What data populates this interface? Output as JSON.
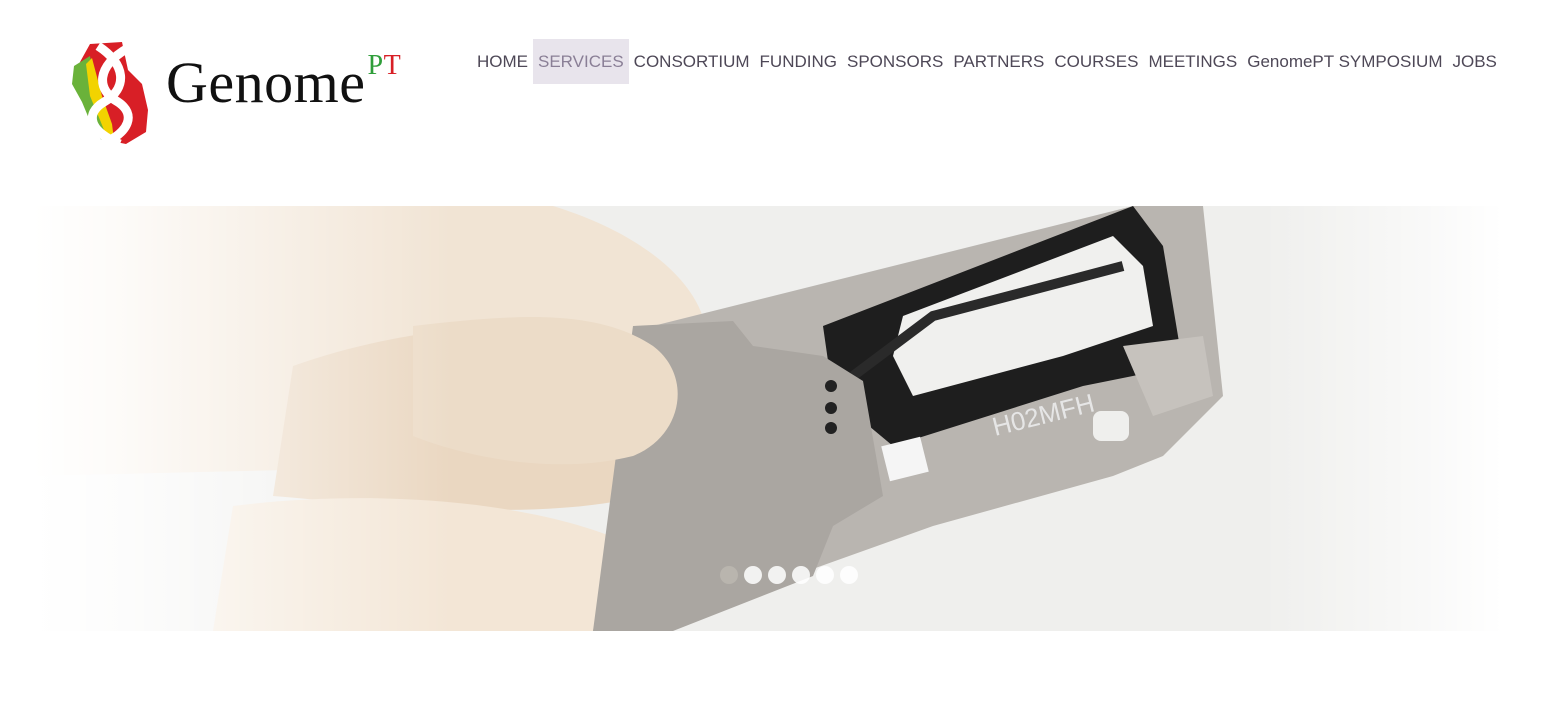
{
  "brand": {
    "name": "Genome",
    "suffix_p": "P",
    "suffix_t": "T",
    "colors": {
      "green": "#2f9e3a",
      "red": "#d81f26",
      "yellow": "#f2d300"
    }
  },
  "nav": {
    "items": [
      {
        "label": "HOME"
      },
      {
        "label": "SERVICES"
      },
      {
        "label": "CONSORTIUM"
      },
      {
        "label": "FUNDING"
      },
      {
        "label": "SPONSORS"
      },
      {
        "label": "PARTNERS"
      },
      {
        "label": "COURSES"
      },
      {
        "label": "MEETINGS"
      },
      {
        "label": "GenomePT SYMPOSIUM"
      },
      {
        "label": "JOBS"
      }
    ],
    "active_index": 1,
    "colors": {
      "text": "#4e4857",
      "active_bg": "#e8e4ec",
      "active_text": "#8a7f96"
    }
  },
  "slider": {
    "slide_label": "H02MFH",
    "dot_count": 6,
    "active_dot": 0
  }
}
